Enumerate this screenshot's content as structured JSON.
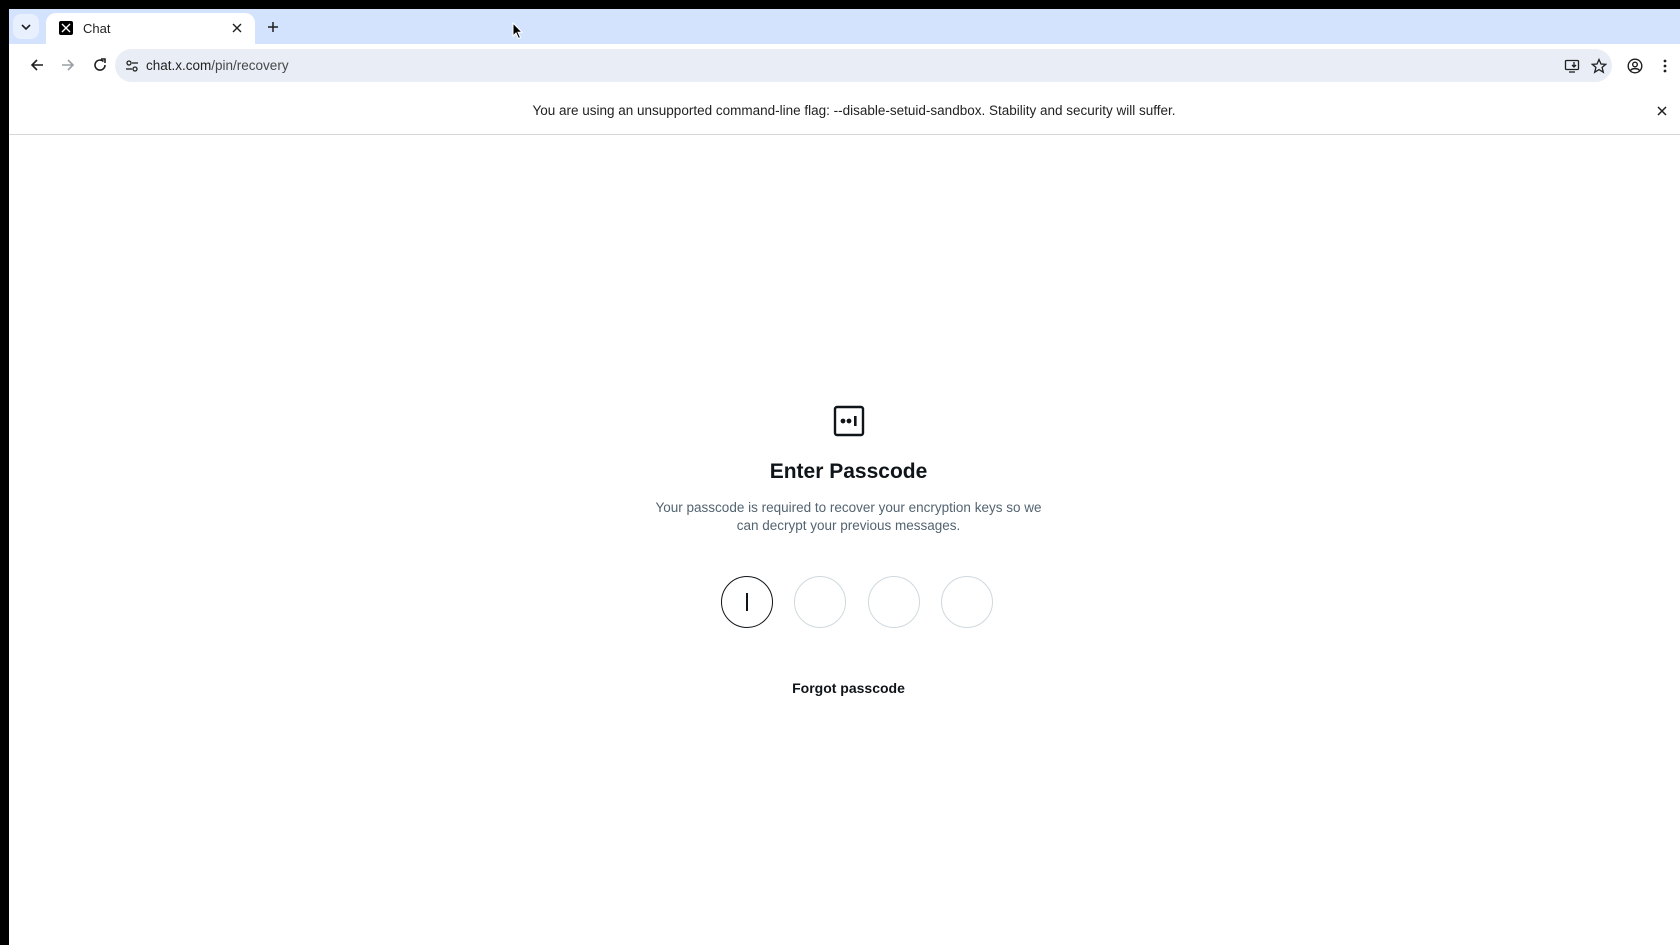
{
  "browser": {
    "tab": {
      "title": "Chat",
      "favicon": "x-logo-icon"
    },
    "url": {
      "host": "chat.x.com",
      "path": "/pin/recovery"
    },
    "infobar": {
      "message": "You are using an unsupported command-line flag: --disable-setuid-sandbox. Stability and security will suffer."
    }
  },
  "page": {
    "icon": "passcode-icon",
    "heading": "Enter Passcode",
    "description": "Your passcode is required to recover your encryption keys so we can decrypt your previous messages.",
    "pin": {
      "length": 4,
      "values": [
        "",
        "",
        "",
        ""
      ],
      "active_index": 0
    },
    "forgot_label": "Forgot passcode"
  },
  "colors": {
    "tabstrip": "#d3e3fd",
    "omnibox": "#e9eef6",
    "text_primary": "#0f1419",
    "text_secondary": "#536471",
    "pin_border": "#cfd9de"
  }
}
